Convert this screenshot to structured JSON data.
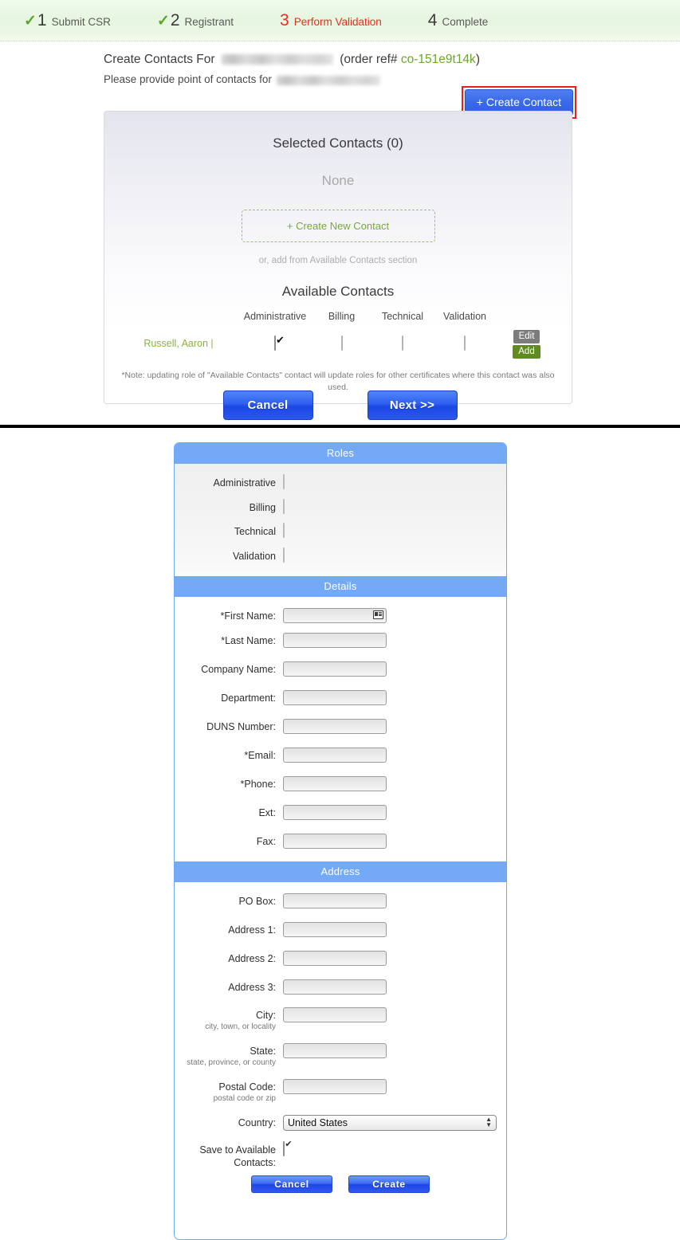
{
  "wizard": {
    "steps": [
      {
        "check": "✓",
        "num": "1",
        "label": "Submit CSR",
        "state": "done"
      },
      {
        "check": "✓",
        "num": "2",
        "label": "Registrant",
        "state": "done"
      },
      {
        "check": "",
        "num": "3",
        "label": "Perform Validation",
        "state": "active"
      },
      {
        "check": "",
        "num": "4",
        "label": "Complete",
        "state": "pending"
      }
    ]
  },
  "page": {
    "title_prefix": "Create Contacts For",
    "title_mid": "(order ref#",
    "order_ref": "co-151e9t14k",
    "title_suffix": ")",
    "subtitle": "Please provide point of contacts for",
    "create_contact_button": "+ Create Contact"
  },
  "selected": {
    "heading": "Selected Contacts (0)",
    "empty_text": "None",
    "create_new_label": "+ Create New Contact",
    "or_add_text": "or, add from Available Contacts section"
  },
  "available": {
    "heading": "Available Contacts",
    "columns": [
      "Administrative",
      "Billing",
      "Technical",
      "Validation"
    ],
    "rows": [
      {
        "name": "Russell, Aaron |",
        "administrative": true,
        "billing": false,
        "technical": false,
        "validation": false,
        "edit_label": "Edit",
        "add_label": "Add"
      }
    ],
    "note": "*Note: updating role of \"Available Contacts\" contact will update roles for other certificates where this contact was also used."
  },
  "wizard_nav": {
    "cancel_label": "Cancel",
    "next_label": "Next >>"
  },
  "form": {
    "roles": {
      "heading": "Roles",
      "items": [
        {
          "label": "Administrative",
          "checked": false
        },
        {
          "label": "Billing",
          "checked": false
        },
        {
          "label": "Technical",
          "checked": false
        },
        {
          "label": "Validation",
          "checked": false
        }
      ]
    },
    "details": {
      "heading": "Details",
      "fields": [
        {
          "label": "*First Name:",
          "value": "",
          "icon": "contact-card-icon"
        },
        {
          "label": "*Last Name:",
          "value": ""
        },
        {
          "label": "Company Name:",
          "value": ""
        },
        {
          "label": "Department:",
          "value": ""
        },
        {
          "label": "DUNS Number:",
          "value": ""
        },
        {
          "label": "*Email:",
          "value": ""
        },
        {
          "label": "*Phone:",
          "value": ""
        },
        {
          "label": "Ext:",
          "value": ""
        },
        {
          "label": "Fax:",
          "value": ""
        }
      ]
    },
    "address": {
      "heading": "Address",
      "fields": [
        {
          "label": "PO Box:",
          "sub": "",
          "value": ""
        },
        {
          "label": "Address 1:",
          "sub": "",
          "value": ""
        },
        {
          "label": "Address 2:",
          "sub": "",
          "value": ""
        },
        {
          "label": "Address 3:",
          "sub": "",
          "value": ""
        },
        {
          "label": "City:",
          "sub": "city, town, or locality",
          "value": ""
        },
        {
          "label": "State:",
          "sub": "state, province, or county",
          "value": ""
        },
        {
          "label": "Postal Code:",
          "sub": "postal code or zip",
          "value": ""
        }
      ],
      "country_label": "Country:",
      "country_value": "United States",
      "country_options": [
        "United States"
      ]
    },
    "save_label_line1": "Save to Available",
    "save_label_line2": "Contacts:",
    "save_checked": true,
    "cancel_label": "Cancel",
    "create_label": "Create"
  },
  "colors": {
    "accent_blue": "#74aaf5",
    "button_blue": "#2f5fe3",
    "green": "#7aa83a",
    "active_red": "#ee2b1f",
    "add_green": "#5f8b20",
    "edit_gray": "#7c7c7c"
  }
}
